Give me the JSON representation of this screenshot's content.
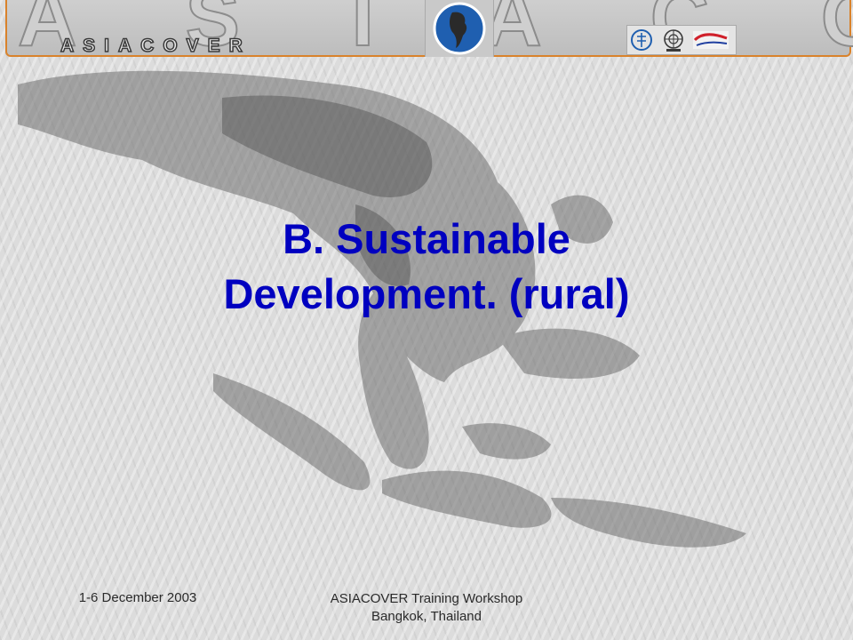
{
  "header": {
    "banner_text": "ASIACOVER",
    "banner_letters_big": "A S I A C O V E R",
    "logo_icons": [
      "globe-map-icon",
      "fao-logo-icon",
      "un-logo-icon",
      "partner-logo-icon"
    ]
  },
  "slide": {
    "title_line1": "B.  Sustainable",
    "title_line2": "Development.  (rural)"
  },
  "footer": {
    "date": "1-6 December 2003",
    "event_line1": "ASIACOVER Training Workshop",
    "event_line2": "Bangkok, Thailand"
  },
  "colors": {
    "title": "#0000c0",
    "banner_border": "#d9822b",
    "background": "#dcdcdc"
  }
}
